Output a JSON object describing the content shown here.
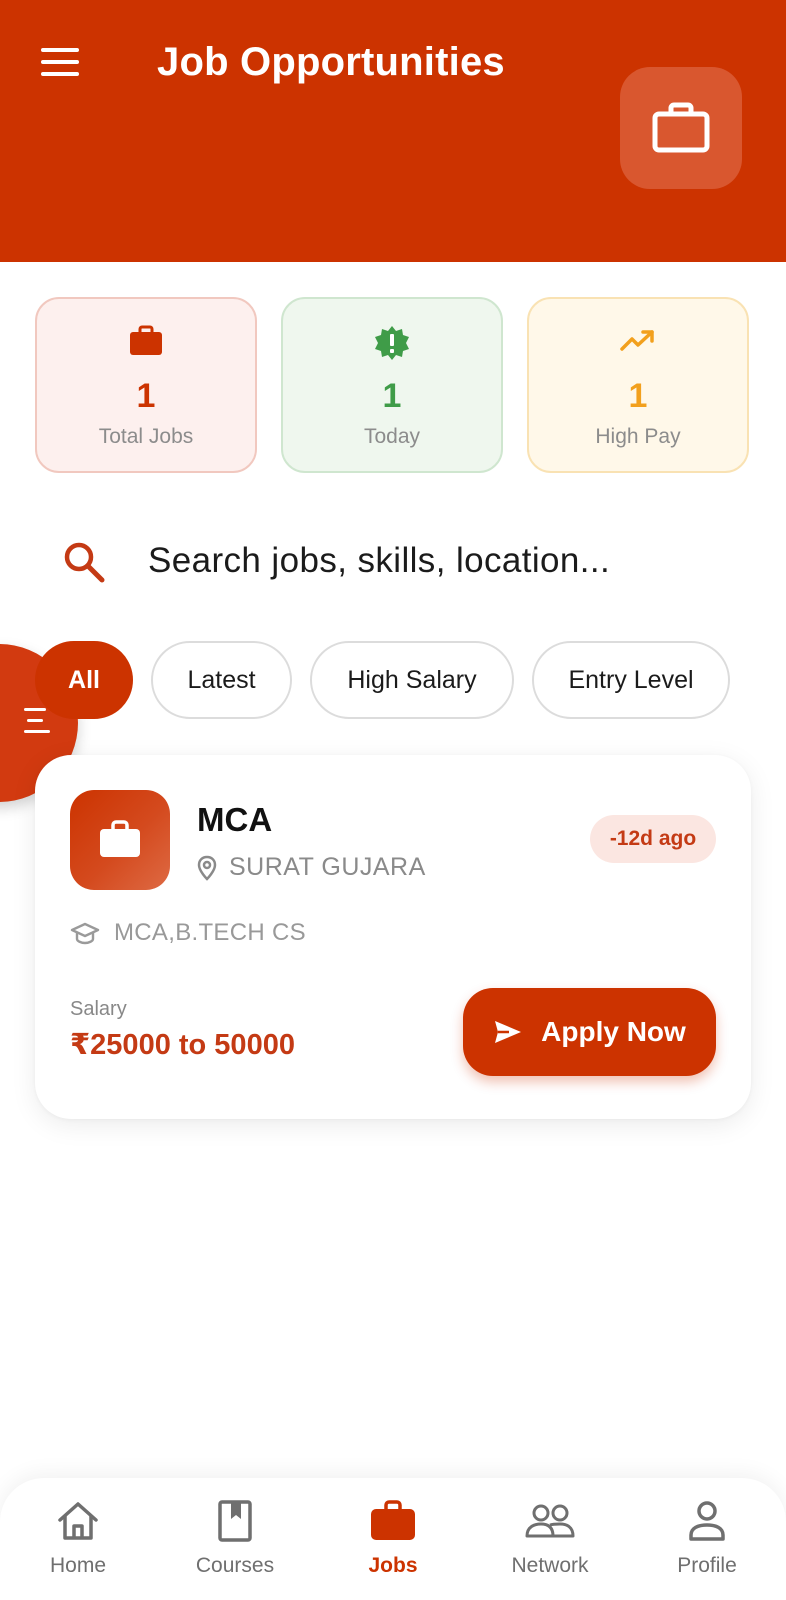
{
  "header": {
    "title": "Job Opportunities",
    "menu_icon": "menu-icon",
    "badge_icon": "briefcase-icon"
  },
  "stats": [
    {
      "value": "1",
      "label": "Total Jobs",
      "icon": "briefcase-icon",
      "color": "#cc3300"
    },
    {
      "value": "1",
      "label": "Today",
      "icon": "new-badge-icon",
      "color": "#3f9c48"
    },
    {
      "value": "1",
      "label": "High Pay",
      "icon": "trending-up-icon",
      "color": "#f2a01d"
    }
  ],
  "search": {
    "placeholder": "Search jobs, skills, location...",
    "value": ""
  },
  "filters": [
    {
      "label": "All",
      "active": true
    },
    {
      "label": "Latest",
      "active": false
    },
    {
      "label": "High Salary",
      "active": false
    },
    {
      "label": "Entry Level",
      "active": false
    }
  ],
  "jobs": [
    {
      "title": "MCA",
      "location": "SURAT GUJARA",
      "posted": "-12d ago",
      "qualification": "MCA,B.TECH CS",
      "salary_label": "Salary",
      "salary": "₹25000 to 50000",
      "apply_label": "Apply Now"
    }
  ],
  "bottom_nav": [
    {
      "label": "Home",
      "icon": "home-icon",
      "active": false
    },
    {
      "label": "Courses",
      "icon": "book-icon",
      "active": false
    },
    {
      "label": "Jobs",
      "icon": "briefcase-icon",
      "active": true
    },
    {
      "label": "Network",
      "icon": "people-icon",
      "active": false
    },
    {
      "label": "Profile",
      "icon": "person-icon",
      "active": false
    }
  ],
  "colors": {
    "primary": "#cc3300",
    "green": "#3f9c48",
    "amber": "#f2a01d",
    "muted_text": "#8c8c8c"
  }
}
